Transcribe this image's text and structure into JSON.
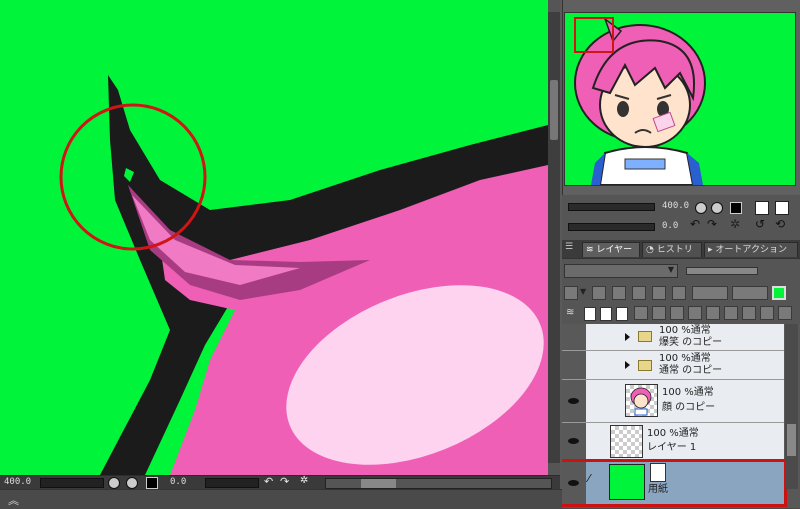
{
  "canvas": {
    "zoom": "400.0",
    "rotation": "0.0",
    "background_color": "#00f53a",
    "stroke_color": "#1b1b1b",
    "hair_color": "#ef5fb5",
    "highlight_color": "#fdd3ef",
    "annotation_color": "#d01515"
  },
  "navigator": {
    "zoom": "400.0",
    "rotation": "0.0"
  },
  "tabs": {
    "layer": "レイヤー",
    "history": "ヒストリー",
    "auto_action": "オートアクション"
  },
  "layers": [
    {
      "mode": "100 %通常",
      "name": "爆笑 のコピー",
      "type": "folder"
    },
    {
      "mode": "100 %通常",
      "name": "通常 のコピー",
      "type": "folder"
    },
    {
      "mode": "100 %通常",
      "name": "顔 のコピー",
      "type": "raster-image"
    },
    {
      "mode": "100 %通常",
      "name": "レイヤー 1",
      "type": "raster-empty"
    },
    {
      "mode": "",
      "name": "用紙",
      "type": "paper",
      "color": "#00f53a",
      "selected": true
    }
  ]
}
